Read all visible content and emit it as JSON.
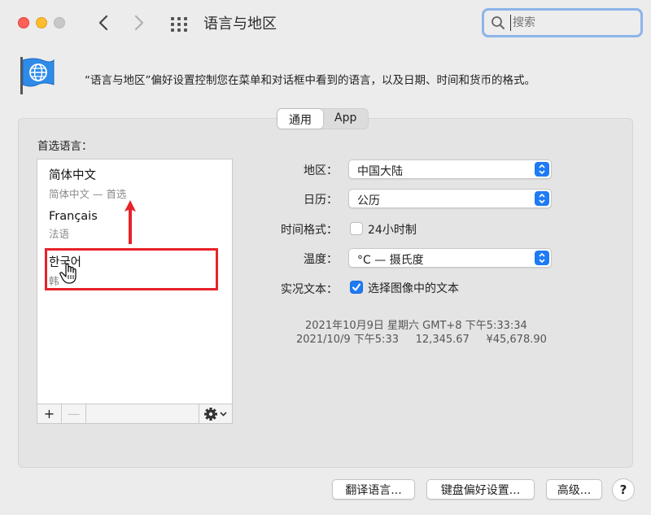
{
  "window": {
    "title": "语言与地区",
    "search_placeholder": "搜索"
  },
  "header": {
    "description": "“语言与地区”偏好设置控制您在菜单和对话框中看到的语言，以及日期、时间和货币的格式。"
  },
  "tabs": [
    {
      "label": "通用",
      "active": true
    },
    {
      "label": "App",
      "active": false
    }
  ],
  "preferred_languages": {
    "label": "首选语言：",
    "items": [
      {
        "name": "简体中文",
        "sub": "简体中文 — 首选"
      },
      {
        "name": "Français",
        "sub": "法语"
      },
      {
        "name": "한국어",
        "sub": "韩"
      }
    ]
  },
  "toolbar": {
    "add_label": "+",
    "remove_label": "—"
  },
  "settings": {
    "region_label": "地区：",
    "region_value": "中国大陆",
    "calendar_label": "日历：",
    "calendar_value": "公历",
    "time_format_label": "时间格式：",
    "time_24h_label": "24小时制",
    "time_24h_checked": false,
    "temperature_label": "温度：",
    "temperature_value": "°C — 摄氏度",
    "live_text_label": "实况文本：",
    "live_text_option": "选择图像中的文本",
    "live_text_checked": true
  },
  "sample": {
    "line1": "2021年10月9日 星期六 GMT+8 下午5:33:34",
    "line2": "2021/10/9 下午5:33     12,345.67     ¥45,678.90"
  },
  "buttons": {
    "translate": "翻译语言...",
    "keyboard": "键盘偏好设置...",
    "advanced": "高级...",
    "help": "?"
  },
  "colors": {
    "accent": "#1e7bf5",
    "annotation": "#e8222a"
  }
}
